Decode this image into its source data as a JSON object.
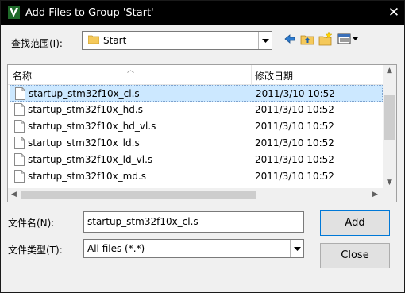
{
  "window": {
    "title": "Add Files to Group 'Start'",
    "close_glyph": "✕"
  },
  "look_in": {
    "label": "查找范围(I):",
    "value": "Start"
  },
  "list": {
    "columns": {
      "name": "名称",
      "date": "修改日期"
    },
    "rows": [
      {
        "name": "startup_stm32f10x_cl.s",
        "date": "2011/3/10 10:52",
        "selected": true
      },
      {
        "name": "startup_stm32f10x_hd.s",
        "date": "2011/3/10 10:52"
      },
      {
        "name": "startup_stm32f10x_hd_vl.s",
        "date": "2011/3/10 10:52"
      },
      {
        "name": "startup_stm32f10x_ld.s",
        "date": "2011/3/10 10:52"
      },
      {
        "name": "startup_stm32f10x_ld_vl.s",
        "date": "2011/3/10 10:52"
      },
      {
        "name": "startup_stm32f10x_md.s",
        "date": "2011/3/10 10:52"
      }
    ]
  },
  "file_name": {
    "label": "文件名(N):",
    "value": "startup_stm32f10x_cl.s"
  },
  "file_type": {
    "label": "文件类型(T):",
    "value": "All files (*.*)"
  },
  "buttons": {
    "add": "Add",
    "close": "Close"
  },
  "colors": {
    "selection": "#cce8ff",
    "titlebar": "#000000",
    "default_button_border": "#0078d7"
  }
}
